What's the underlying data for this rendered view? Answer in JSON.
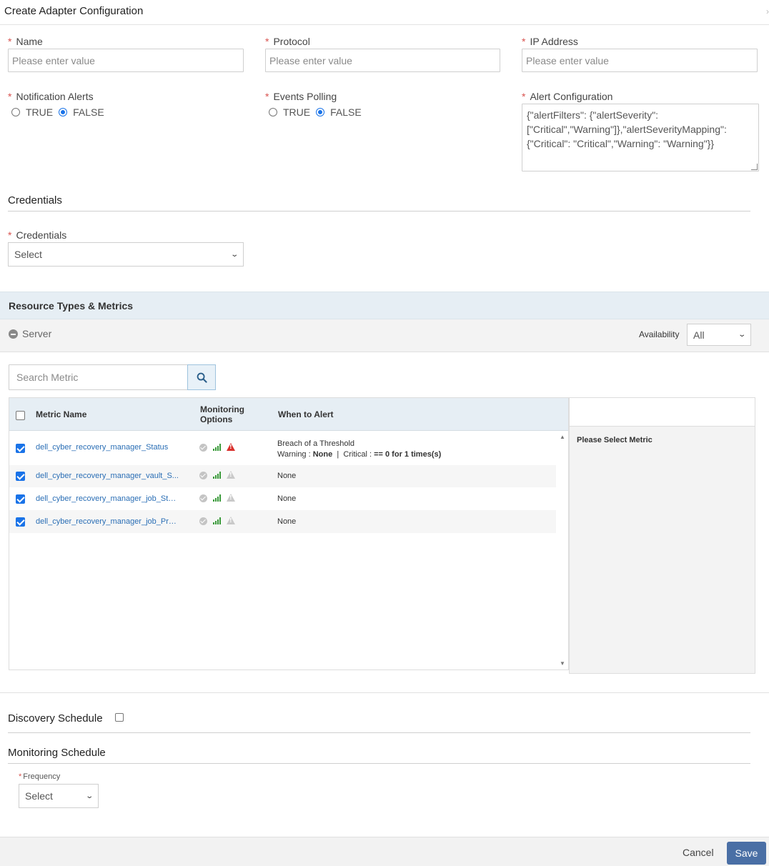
{
  "dialog": {
    "title": "Create Adapter Configuration"
  },
  "fields": {
    "name": {
      "label": "Name",
      "placeholder": "Please enter value"
    },
    "protocol": {
      "label": "Protocol",
      "placeholder": "Please enter value"
    },
    "ip_address": {
      "label": "IP Address",
      "placeholder": "Please enter value"
    },
    "notification_alerts": {
      "label": "Notification Alerts",
      "true_label": "TRUE",
      "false_label": "FALSE",
      "selected": "FALSE"
    },
    "events_polling": {
      "label": "Events Polling",
      "true_label": "TRUE",
      "false_label": "FALSE",
      "selected": "FALSE"
    },
    "alert_configuration": {
      "label": "Alert Configuration",
      "value": "{\"alertFilters\": {\"alertSeverity\":\n[\"Critical\",\"Warning\"]},\"alertSeverityMapping\":\n{\"Critical\": \"Critical\",\"Warning\": \"Warning\"}}"
    }
  },
  "credentials_section": {
    "title": "Credentials",
    "field_label": "Credentials",
    "select_value": "Select"
  },
  "resource_types": {
    "title": "Resource Types & Metrics",
    "group_label": "Server",
    "availability_label": "Availability",
    "availability_value": "All",
    "search_placeholder": "Search Metric",
    "columns": {
      "metric_name": "Metric Name",
      "monitoring_options_1": "Monitoring",
      "monitoring_options_2": "Options",
      "when_to_alert": "When to Alert"
    },
    "rows": [
      {
        "name": "dell_cyber_recovery_manager_Status",
        "checked": true,
        "alert_line1": "Breach of a Threshold",
        "warning_label": "Warning : ",
        "warning_value": "None",
        "critical_label": "  |  Critical : ",
        "critical_value": "== 0 for 1 times(s)",
        "warn_color": "#d9302c"
      },
      {
        "name": "dell_cyber_recovery_manager_vault_S...",
        "checked": true,
        "alert_line1": "None"
      },
      {
        "name": "dell_cyber_recovery_manager_job_Sta...",
        "checked": true,
        "alert_line1": "None"
      },
      {
        "name": "dell_cyber_recovery_manager_job_Pro...",
        "checked": true,
        "alert_line1": "None"
      }
    ],
    "detail_placeholder": "Please Select Metric"
  },
  "discovery_schedule": {
    "title": "Discovery Schedule",
    "checked": false
  },
  "monitoring_schedule": {
    "title": "Monitoring Schedule",
    "frequency_label": "Frequency",
    "frequency_value": "Select"
  },
  "footer": {
    "cancel_label": "Cancel",
    "save_label": "Save"
  },
  "colors": {
    "accent": "#1a73e8",
    "link": "#2a6eb5",
    "required": "#d9534f",
    "save_button": "#4a6fa5",
    "ok_green": "#3a9a3a"
  }
}
